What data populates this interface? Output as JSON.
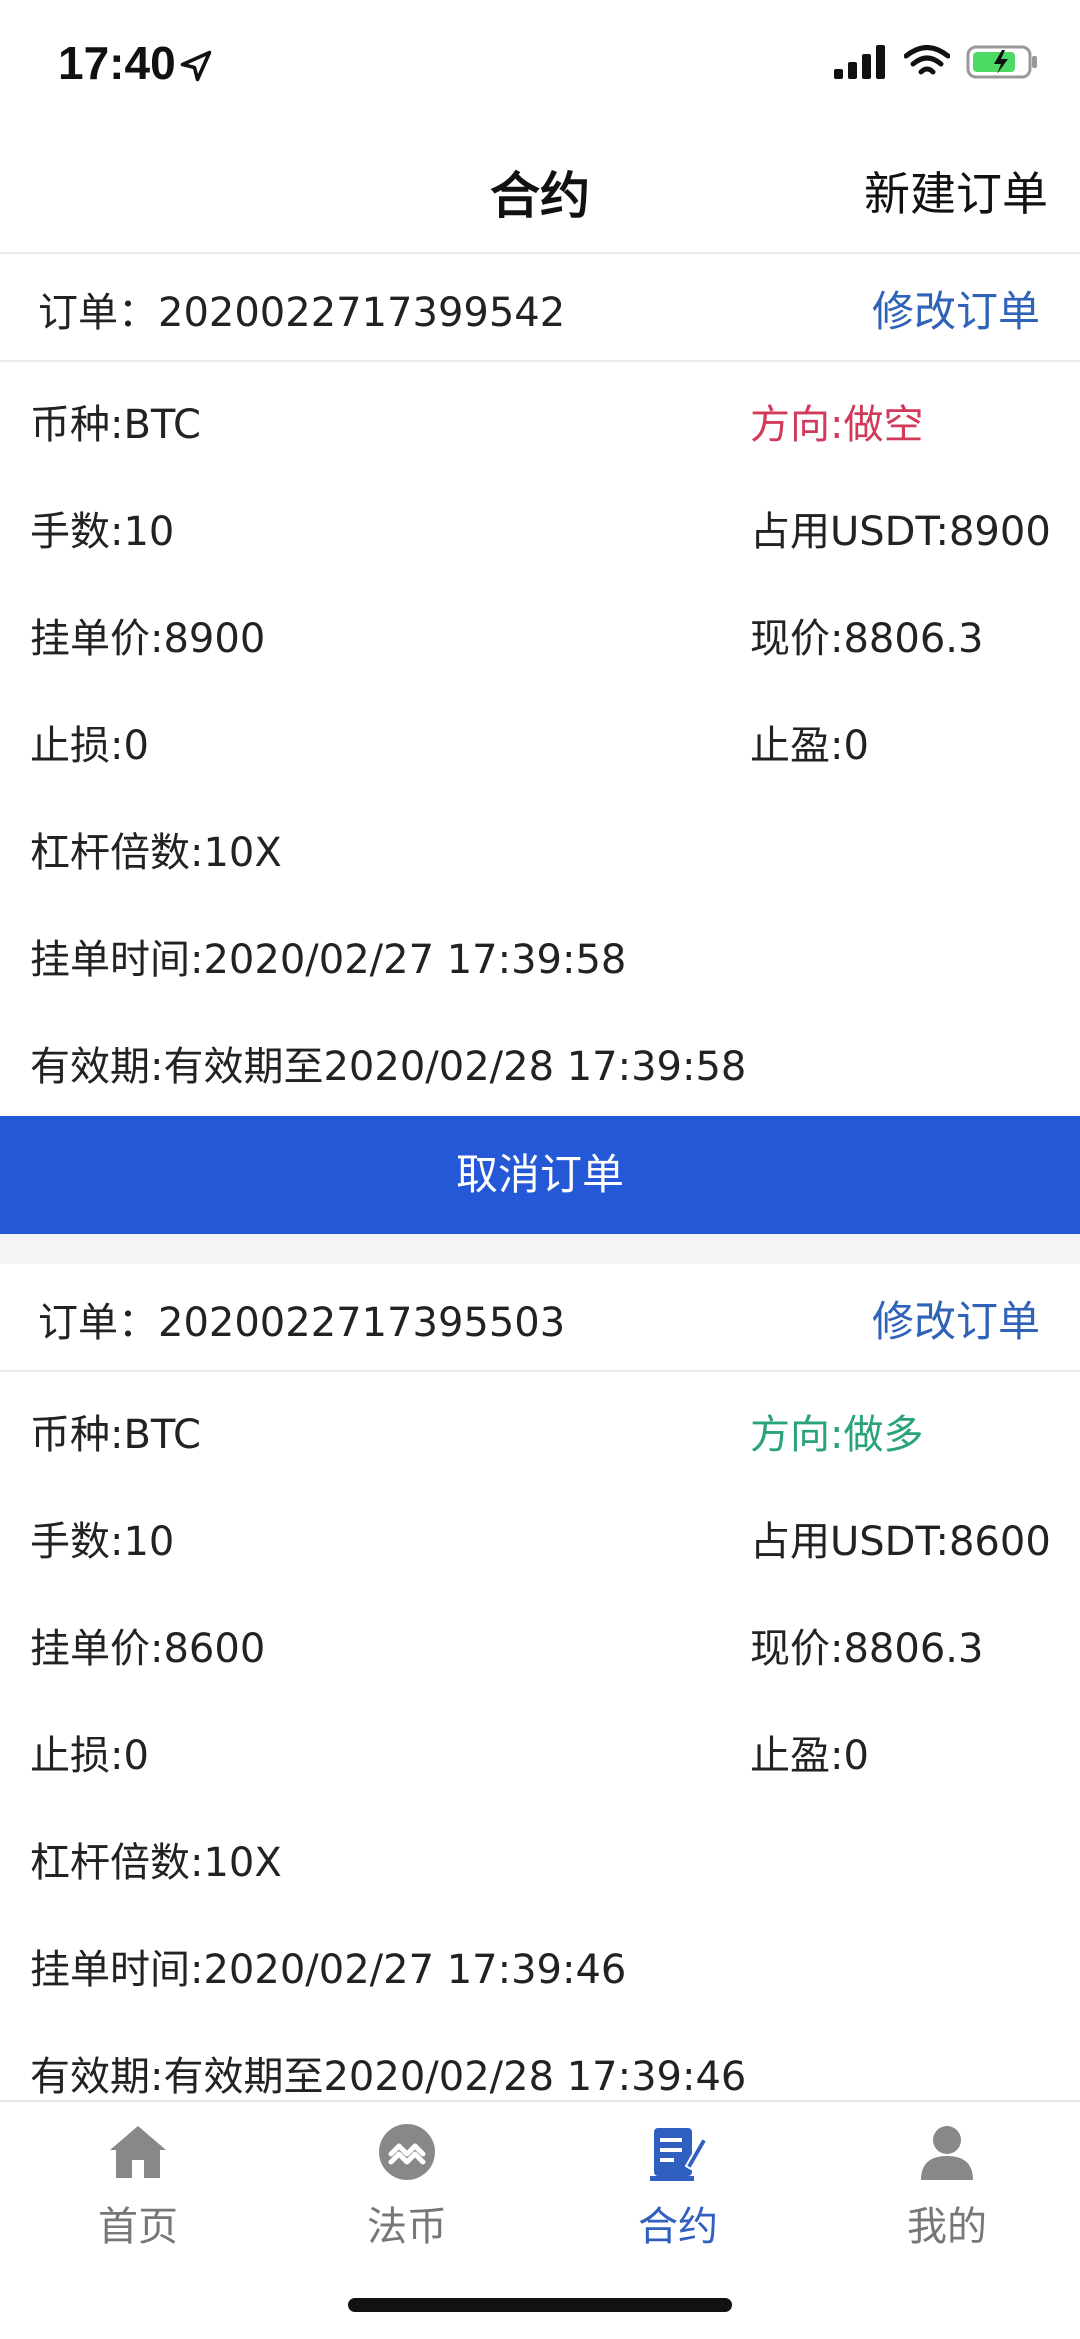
{
  "status": {
    "time": "17:40"
  },
  "nav": {
    "title": "合约",
    "action": "新建订单"
  },
  "orders": [
    {
      "id_label": "订单：2020022717399542",
      "edit_label": "修改订单",
      "coin": "币种:BTC",
      "direction": "方向:做空",
      "lots": "手数:10",
      "usdt": "占用USDT:8900",
      "order_price": "挂单价:8900",
      "current_price": "现价:8806.3",
      "stop_loss": "止损:0",
      "take_profit": "止盈:0",
      "leverage": "杠杆倍数:10X",
      "order_time": "挂单时间:2020/02/27 17:39:58",
      "validity": "有效期:有效期至2020/02/28 17:39:58",
      "cancel_label": "取消订单"
    },
    {
      "id_label": "订单：2020022717395503",
      "edit_label": "修改订单",
      "coin": "币种:BTC",
      "direction": "方向:做多",
      "lots": "手数:10",
      "usdt": "占用USDT:8600",
      "order_price": "挂单价:8600",
      "current_price": "现价:8806.3",
      "stop_loss": "止损:0",
      "take_profit": "止盈:0",
      "leverage": "杠杆倍数:10X",
      "order_time": "挂单时间:2020/02/27 17:39:46",
      "validity": "有效期:有效期至2020/02/28 17:39:46"
    }
  ],
  "colors": {
    "accent_blue": "#2458d6",
    "link_blue": "#2f63b8",
    "short_red": "#d23a5a",
    "long_green": "#2aa37a"
  },
  "tabs": [
    {
      "label": "首页",
      "icon": "home-icon",
      "active": false
    },
    {
      "label": "法币",
      "icon": "fiat-icon",
      "active": false
    },
    {
      "label": "合约",
      "icon": "contract-icon",
      "active": true
    },
    {
      "label": "我的",
      "icon": "profile-icon",
      "active": false
    }
  ]
}
